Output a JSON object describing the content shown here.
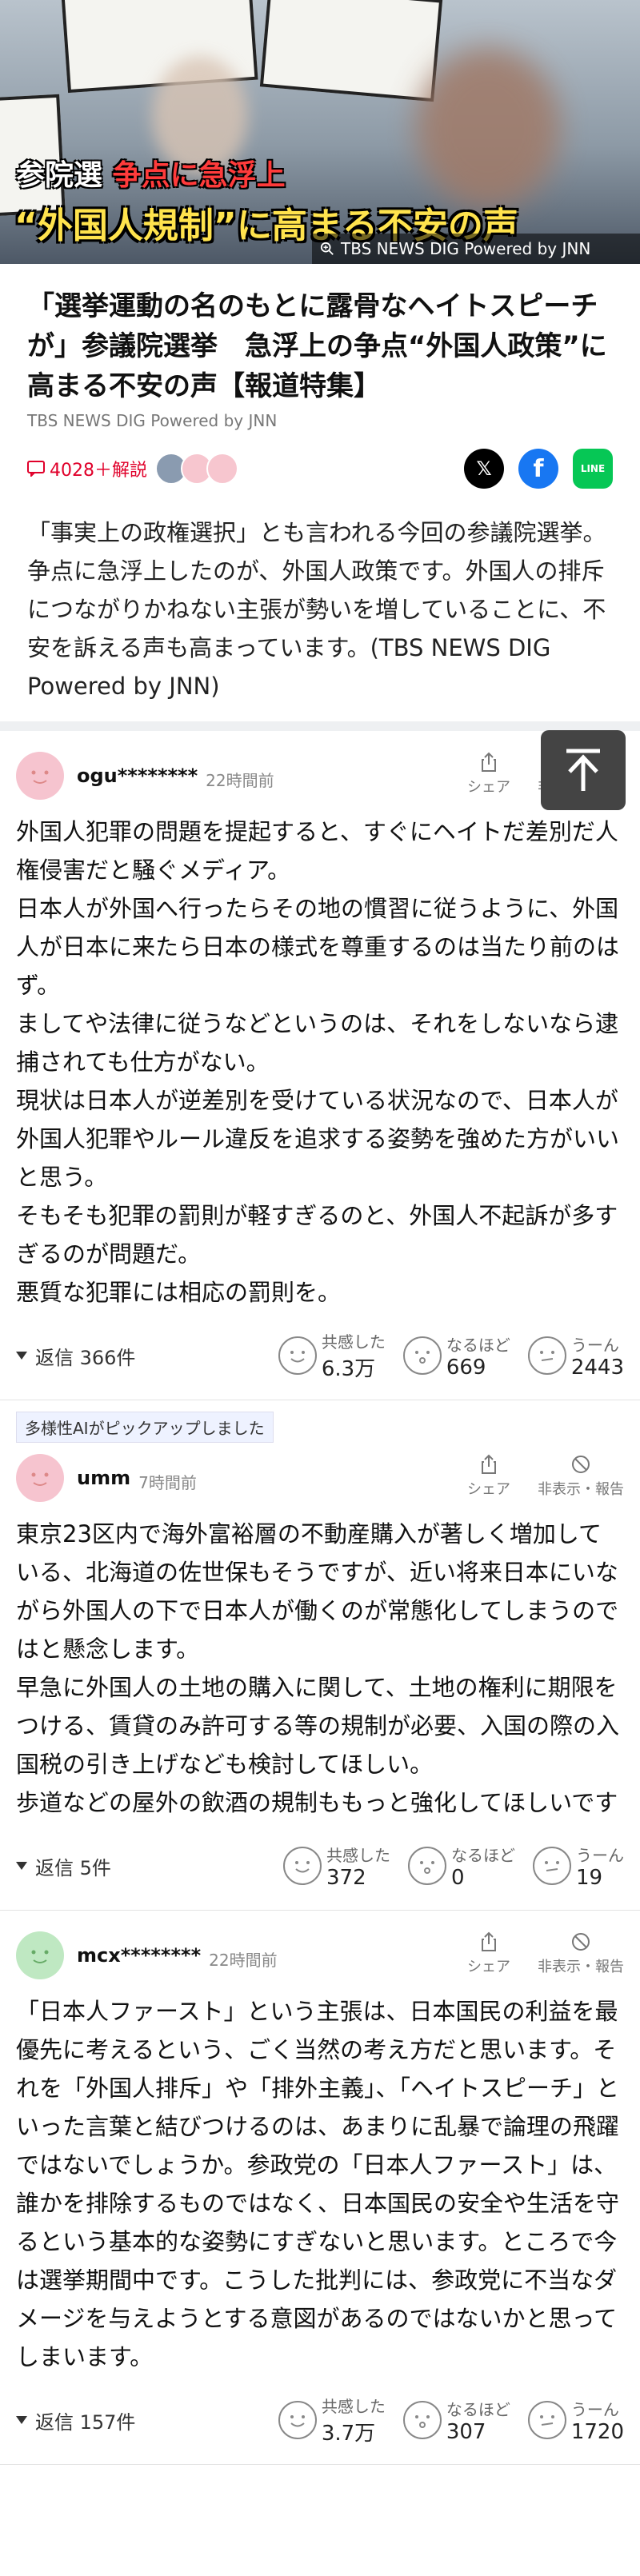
{
  "hero": {
    "headline_prefix": "参院選",
    "headline_red": "争点に急浮上",
    "quote": "“外国人規制”に高まる不安の声",
    "credit": "TBS NEWS DIG Powered by JNN"
  },
  "article": {
    "title": "「選挙運動の名のもとに露骨なヘイトスピーチが」参議院選挙　急浮上の争点“外国人政策”に高まる不安の声【報道特集】",
    "source": "TBS NEWS DIG Powered by JNN",
    "comment_count": "4028＋解説",
    "lede": "「事実上の政権選択」とも言われる今回の参議院選挙。争点に急浮上したのが、外国人政策です。外国人の排斥につながりかねない主張が勢いを増していることに、不安を訴える声も高まっています。(TBS NEWS DIG Powered by JNN)"
  },
  "colors": {
    "accent_red": "#e0002a",
    "x": "#000000",
    "facebook": "#1877f2",
    "line": "#06c755"
  },
  "share": {
    "line_label": "LINE"
  },
  "labels": {
    "share": "シェア",
    "hide_report": "非表示・報告",
    "empathy": "共感した",
    "indeed": "なるほど",
    "hmm": "うーん"
  },
  "pickup_badge": "多様性AIがピックアップしました",
  "comments": [
    {
      "user": "ogu********",
      "time": "22時間前",
      "avatar": "pink",
      "body": "外国人犯罪の問題を提起すると、すぐにヘイトだ差別だ人権侵害だと騒ぐメディア。\n日本人が外国へ行ったらその地の慣習に従うように、外国人が日本に来たら日本の様式を尊重するのは当たり前のはず。\nましてや法律に従うなどというのは、それをしないなら逮捕されても仕方がない。\n現状は日本人が逆差別を受けている状況なので、日本人が外国人犯罪やルール違反を追求する姿勢を強めた方がいいと思う。\nそもそも犯罪の罰則が軽すぎるのと、外国人不起訴が多すぎるのが問題だ。\n悪質な犯罪には相応の罰則を。",
      "replies": "返信 366件",
      "empathy": "6.3万",
      "indeed": "669",
      "hmm": "2443"
    },
    {
      "user": "umm",
      "time": "7時間前",
      "avatar": "pink",
      "body": "東京23区内で海外富裕層の不動産購入が著しく増加している、北海道の佐世保もそうですが、近い将来日本にいながら外国人の下で日本人が働くのが常態化してしまうのではと懸念します。\n早急に外国人の土地の購入に関して、土地の権利に期限をつける、賃貸のみ許可する等の規制が必要、入国の際の入国税の引き上げなども検討してほしい。\n歩道などの屋外の飲酒の規制ももっと強化してほしいです",
      "replies": "返信 5件",
      "empathy": "372",
      "indeed": "0",
      "hmm": "19"
    },
    {
      "user": "mcx********",
      "time": "22時間前",
      "avatar": "green",
      "body": "「日本人ファースト」という主張は、日本国民の利益を最優先に考えるという、ごく当然の考え方だと思います。それを「外国人排斥」や「排外主義」、「ヘイトスピーチ」といった言葉と結びつけるのは、あまりに乱暴で論理の飛躍ではないでしょうか。参政党の「日本人ファースト」は、誰かを排除するものではなく、日本国民の安全や生活を守るという基本的な姿勢にすぎないと思います。ところで今は選挙期間中です。こうした批判には、参政党に不当なダメージを与えようとする意図があるのではないかと思ってしまいます。",
      "replies": "返信 157件",
      "empathy": "3.7万",
      "indeed": "307",
      "hmm": "1720"
    }
  ]
}
